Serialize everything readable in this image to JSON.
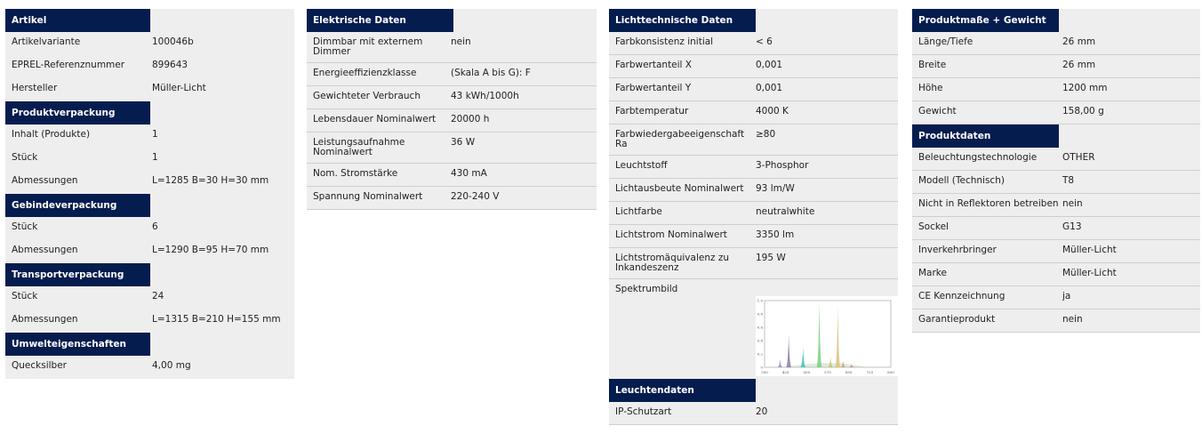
{
  "col1": [
    {
      "head": "Artikel",
      "rows": [
        {
          "k": "Artikelvariante",
          "v": "100046b"
        },
        {
          "k": "EPREL-Referenznummer",
          "v": "899643"
        },
        {
          "k": "Hersteller",
          "v": "Müller-Licht"
        }
      ]
    },
    {
      "head": "Produktverpackung",
      "rows": [
        {
          "k": "Inhalt (Produkte)",
          "v": "1"
        },
        {
          "k": "Stück",
          "v": "1"
        },
        {
          "k": "Abmessungen",
          "v": "L=1285 B=30 H=30 mm"
        }
      ]
    },
    {
      "head": "Gebindeverpackung",
      "rows": [
        {
          "k": "Stück",
          "v": "6"
        },
        {
          "k": "Abmessungen",
          "v": "L=1290 B=95 H=70 mm"
        }
      ]
    },
    {
      "head": "Transportverpackung",
      "rows": [
        {
          "k": "Stück",
          "v": "24"
        },
        {
          "k": "Abmessungen",
          "v": "L=1315 B=210 H=155 mm"
        }
      ]
    },
    {
      "head": "Umwelteigenschaften",
      "rows": [
        {
          "k": "Quecksilber",
          "v": "4,00 mg"
        }
      ]
    }
  ],
  "col2": [
    {
      "head": "Elektrische Daten",
      "rows": [
        {
          "k": "Dimmbar mit externem Dimmer",
          "v": "nein"
        },
        {
          "k": "Energieeffizienzklasse",
          "v": "(Skala A bis G): F"
        },
        {
          "k": "Gewichteter Verbrauch",
          "v": "43 kWh/1000h"
        },
        {
          "k": "Lebensdauer Nominalwert",
          "v": "20000 h"
        },
        {
          "k": "Leistungsaufnahme Nominalwert",
          "v": "36 W"
        },
        {
          "k": "Nom. Stromstärke",
          "v": "430 mA"
        },
        {
          "k": "Spannung Nominalwert",
          "v": "220-240 V"
        }
      ]
    }
  ],
  "col3": [
    {
      "head": "Lichttechnische Daten",
      "rows": [
        {
          "k": "Farbkonsistenz initial",
          "v": "< 6"
        },
        {
          "k": "Farbwertanteil X",
          "v": "0,001"
        },
        {
          "k": "Farbwertanteil Y",
          "v": "0,001"
        },
        {
          "k": "Farbtemperatur",
          "v": "4000 K"
        },
        {
          "k": "Farbwiedergabeeigenschaft Ra",
          "v": "≥80"
        },
        {
          "k": "Leuchtstoff",
          "v": "3-Phosphor"
        },
        {
          "k": "Lichtausbeute Nominalwert",
          "v": "93 lm/W"
        },
        {
          "k": "Lichtfarbe",
          "v": "neutralwhite"
        },
        {
          "k": "Lichtstrom Nominalwert",
          "v": "3350 lm"
        },
        {
          "k": "Lichtstromäquivalenz zu Inkandeszenz",
          "v": "195 W"
        },
        {
          "k": "Spektrumbild",
          "v": ""
        }
      ]
    },
    {
      "head": "Leuchtendaten",
      "rows": [
        {
          "k": "IP-Schutzart",
          "v": "20"
        }
      ]
    }
  ],
  "col4": [
    {
      "head": "Produktmaße + Gewicht",
      "rows": [
        {
          "k": "Länge/Tiefe",
          "v": "26 mm"
        },
        {
          "k": "Breite",
          "v": "26 mm"
        },
        {
          "k": "Höhe",
          "v": "1200 mm"
        },
        {
          "k": "Gewicht",
          "v": "158,00 g"
        }
      ]
    },
    {
      "head": "Produktdaten",
      "rows": [
        {
          "k": "Beleuchtungstechnologie",
          "v": "OTHER"
        },
        {
          "k": "Modell (Technisch)",
          "v": "T8"
        },
        {
          "k": "Nicht in Reflektoren betreiben",
          "v": "nein"
        },
        {
          "k": "Sockel",
          "v": "G13"
        },
        {
          "k": "Inverkehrbringer",
          "v": "Müller-Licht"
        },
        {
          "k": "Marke",
          "v": "Müller-Licht"
        },
        {
          "k": "CE Kennzeichnung",
          "v": "ja"
        },
        {
          "k": "Garantieprodukt",
          "v": "nein"
        }
      ]
    }
  ],
  "spectrum": {
    "x_ticks": [
      "350",
      "425",
      "500",
      "575",
      "650",
      "725",
      "800"
    ],
    "y_ticks": [
      "1.0",
      "0.8",
      "0.6",
      "0.4",
      "0.2",
      "0"
    ],
    "peaks": [
      {
        "x": 405,
        "h": 0.12,
        "color": "#9b8fb4"
      },
      {
        "x": 436,
        "h": 0.5,
        "color": "#8a7fa0"
      },
      {
        "x": 487,
        "h": 0.3,
        "color": "#3fbfbf"
      },
      {
        "x": 545,
        "h": 0.98,
        "color": "#7ad07a"
      },
      {
        "x": 585,
        "h": 0.15,
        "color": "#c9c26a"
      },
      {
        "x": 611,
        "h": 0.92,
        "color": "#d8c47a"
      },
      {
        "x": 630,
        "h": 0.1,
        "color": "#d89a6a"
      },
      {
        "x": 660,
        "h": 0.05,
        "color": "#c88a8a"
      }
    ]
  }
}
